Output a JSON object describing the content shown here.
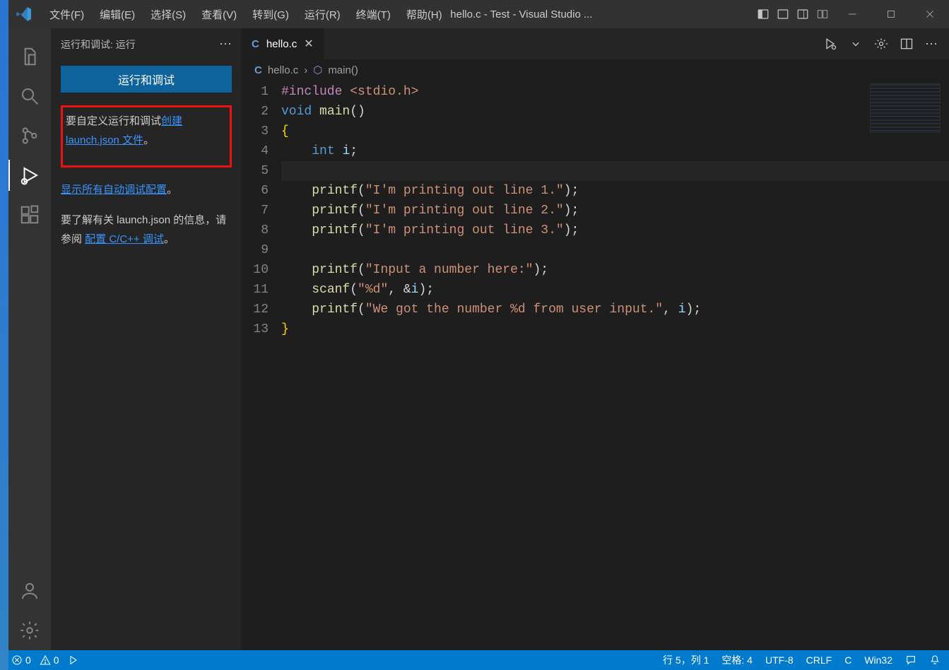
{
  "titlebar": {
    "menus": [
      "文件(F)",
      "编辑(E)",
      "选择(S)",
      "查看(V)",
      "转到(G)",
      "运行(R)",
      "终端(T)",
      "帮助(H)"
    ],
    "title": "hello.c - Test - Visual Studio ..."
  },
  "sidebar": {
    "header": "运行和调试: 运行",
    "run_btn": "运行和调试",
    "p1_prefix": "要自定义运行和调试",
    "p1_link": "创建 launch.json 文件",
    "p1_suffix": "。",
    "p2_link": "显示所有自动调试配置",
    "p2_suffix": "。",
    "p3_prefix": "要了解有关 launch.json 的信息，请参阅 ",
    "p3_link": "配置 C/C++ 调试",
    "p3_suffix": "。"
  },
  "tab": {
    "name": "hello.c"
  },
  "breadcrumb": {
    "file": "hello.c",
    "symbol": "main()"
  },
  "code": {
    "lines": [
      {
        "n": 1,
        "html": "<span class='inc'>#include</span> <span class='lib'>&lt;stdio.h&gt;</span>"
      },
      {
        "n": 2,
        "html": "<span class='type'>void</span> <span class='fn'>main</span>()"
      },
      {
        "n": 3,
        "html": "<span class='brace'>{</span>"
      },
      {
        "n": 4,
        "html": "    <span class='type'>int</span> <span class='var'>i</span>;"
      },
      {
        "n": 5,
        "html": "",
        "current": true
      },
      {
        "n": 6,
        "html": "    <span class='fn'>printf</span>(<span class='str'>\"I'm printing out line 1.\"</span>);"
      },
      {
        "n": 7,
        "html": "    <span class='fn'>printf</span>(<span class='str'>\"I'm printing out line 2.\"</span>);"
      },
      {
        "n": 8,
        "html": "    <span class='fn'>printf</span>(<span class='str'>\"I'm printing out line 3.\"</span>);"
      },
      {
        "n": 9,
        "html": ""
      },
      {
        "n": 10,
        "html": "    <span class='fn'>printf</span>(<span class='str'>\"Input a number here:\"</span>);"
      },
      {
        "n": 11,
        "html": "    <span class='fn'>scanf</span>(<span class='str'>\"%d\"</span>, &amp;<span class='var'>i</span>);"
      },
      {
        "n": 12,
        "html": "    <span class='fn'>printf</span>(<span class='str'>\"We got the number %d from user input.\"</span>, <span class='var'>i</span>);"
      },
      {
        "n": 13,
        "html": "<span class='brace'>}</span>"
      }
    ]
  },
  "statusbar": {
    "errors": "0",
    "warnings": "0",
    "cursor": "行 5，列 1",
    "spaces": "空格: 4",
    "encoding": "UTF-8",
    "eol": "CRLF",
    "lang": "C",
    "platform": "Win32"
  }
}
